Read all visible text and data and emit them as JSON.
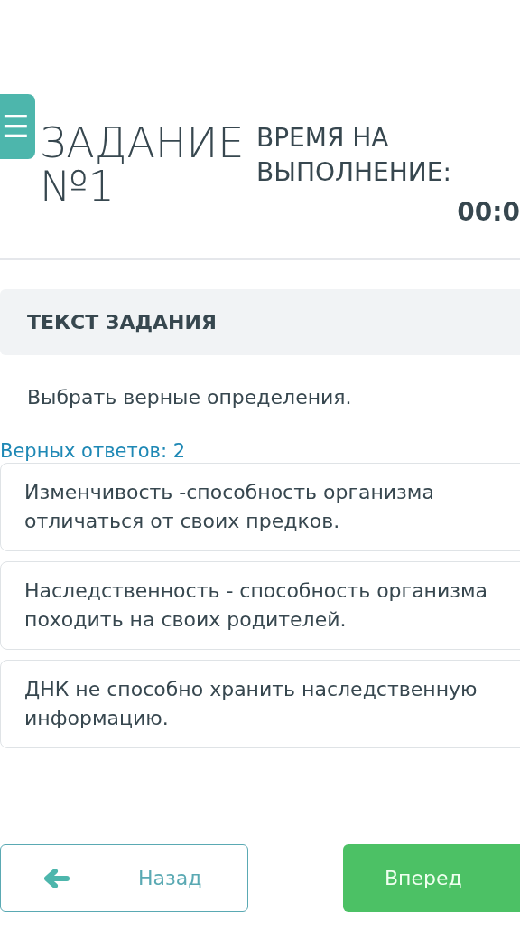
{
  "header": {
    "menu_icon": "☰",
    "title_line1": "ЗАДАНИЕ",
    "title_line2": "№1",
    "timer_label": "ВРЕМЯ НА ВЫПОЛНЕНИЕ:",
    "timer_value": "00:0"
  },
  "task": {
    "heading": "ТЕКСТ ЗАДАНИЯ",
    "text": "Выбрать верные определения.",
    "answers_count": "Верных ответов: 2"
  },
  "answers": [
    {
      "text": "Изменчивость -способность организма отличаться от своих предков."
    },
    {
      "text": "Наследственность - способность организма походить на своих родителей."
    },
    {
      "text": "ДНК не способно хранить наследственную информацию."
    }
  ],
  "nav": {
    "back": "Назад",
    "forward": "Вперед"
  }
}
